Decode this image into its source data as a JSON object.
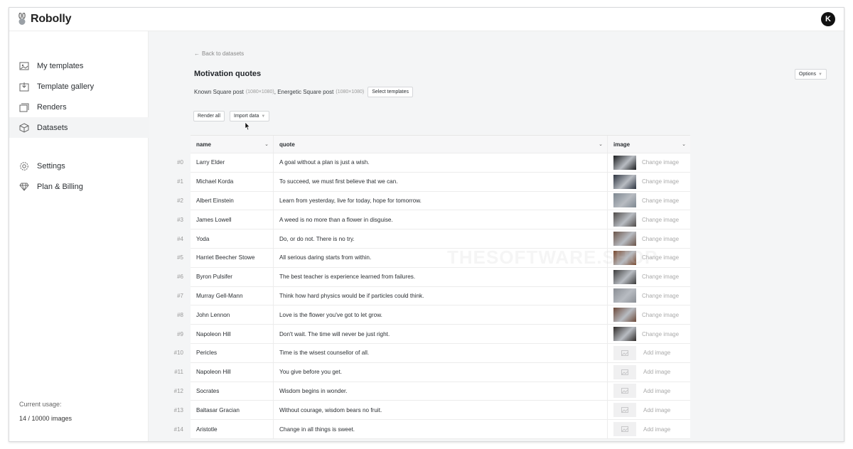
{
  "app": {
    "name": "Robolly",
    "avatar_initial": "K"
  },
  "sidebar": {
    "items": [
      {
        "label": "My templates",
        "icon": "templates-icon"
      },
      {
        "label": "Template gallery",
        "icon": "gallery-icon"
      },
      {
        "label": "Renders",
        "icon": "renders-icon"
      },
      {
        "label": "Datasets",
        "icon": "datasets-icon",
        "active": true
      },
      {
        "label": "Settings",
        "icon": "gear-icon"
      },
      {
        "label": "Plan & Billing",
        "icon": "diamond-icon"
      }
    ],
    "usage_label": "Current usage:",
    "usage_value": "14 / 10000 images"
  },
  "main": {
    "back_link": "Back to datasets",
    "title": "Motivation quotes",
    "templates": [
      {
        "name": "Known Square post",
        "size": "(1080×1080)"
      },
      {
        "name": "Energetic Square post",
        "size": "(1080×1080)"
      }
    ],
    "select_templates_label": "Select templates",
    "options_label": "Options",
    "render_all_label": "Render all",
    "import_data_label": "Import data"
  },
  "table": {
    "columns": [
      "name",
      "quote",
      "image"
    ],
    "change_image_label": "Change image",
    "add_image_label": "Add image",
    "rows": [
      {
        "num": "#0",
        "name": "Larry Elder",
        "quote": "A goal without a plan is just a wish.",
        "has_image": true,
        "thumb": "#1a1c1e"
      },
      {
        "num": "#1",
        "name": "Michael Korda",
        "quote": "To succeed, we must first believe that we can.",
        "has_image": true,
        "thumb": "#2d3440"
      },
      {
        "num": "#2",
        "name": "Albert Einstein",
        "quote": "Learn from yesterday, live for today, hope for tomorrow.",
        "has_image": true,
        "thumb": "#7d8790"
      },
      {
        "num": "#3",
        "name": "James Lowell",
        "quote": "A weed is no more than a flower in disguise.",
        "has_image": true,
        "thumb": "#4e4a48"
      },
      {
        "num": "#4",
        "name": "Yoda",
        "quote": "Do, or do not. There is no try.",
        "has_image": true,
        "thumb": "#6a5448"
      },
      {
        "num": "#5",
        "name": "Harriet Beecher Stowe",
        "quote": "All serious daring starts from within.",
        "has_image": true,
        "thumb": "#7a4a30"
      },
      {
        "num": "#6",
        "name": "Byron Pulsifer",
        "quote": "The best teacher is experience learned from failures.",
        "has_image": true,
        "thumb": "#3c3c3c"
      },
      {
        "num": "#7",
        "name": "Murray Gell-Mann",
        "quote": "Think how hard physics would be if particles could think.",
        "has_image": true,
        "thumb": "#8a8e94"
      },
      {
        "num": "#8",
        "name": "John Lennon",
        "quote": "Love is the flower you've got to let grow.",
        "has_image": true,
        "thumb": "#6b4838"
      },
      {
        "num": "#9",
        "name": "Napoleon Hill",
        "quote": "Don't wait. The time will never be just right.",
        "has_image": true,
        "thumb": "#2e2a28"
      },
      {
        "num": "#10",
        "name": "Pericles",
        "quote": "Time is the wisest counsellor of all.",
        "has_image": false
      },
      {
        "num": "#11",
        "name": "Napoleon Hill",
        "quote": "You give before you get.",
        "has_image": false
      },
      {
        "num": "#12",
        "name": "Socrates",
        "quote": "Wisdom begins in wonder.",
        "has_image": false
      },
      {
        "num": "#13",
        "name": "Baltasar Gracian",
        "quote": "Without courage, wisdom bears no fruit.",
        "has_image": false
      },
      {
        "num": "#14",
        "name": "Aristotle",
        "quote": "Change in all things is sweet.",
        "has_image": false
      }
    ]
  },
  "watermark": "THESOFTWARE.SHOP"
}
